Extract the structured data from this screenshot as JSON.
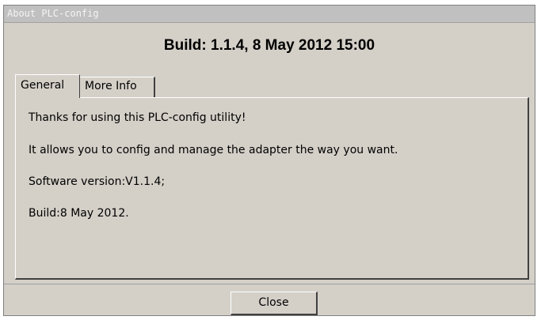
{
  "window": {
    "title": "About PLC-config"
  },
  "header": {
    "build": "Build: 1.1.4, 8 May 2012 15:00"
  },
  "tabs": [
    {
      "label": "General",
      "selected": true
    },
    {
      "label": "More Info",
      "selected": false
    }
  ],
  "general": {
    "lines": [
      "Thanks for using this PLC-config utility!",
      "It allows you to config and manage the adapter the way you want.",
      "Software version:V1.1.4;",
      "Build:8 May 2012."
    ]
  },
  "footer": {
    "close_label": "Close"
  },
  "colors": {
    "window_bg": "#d4d0c8",
    "titlebar_bg": "#c0c0c0",
    "title_text": "#f4f4f4"
  }
}
